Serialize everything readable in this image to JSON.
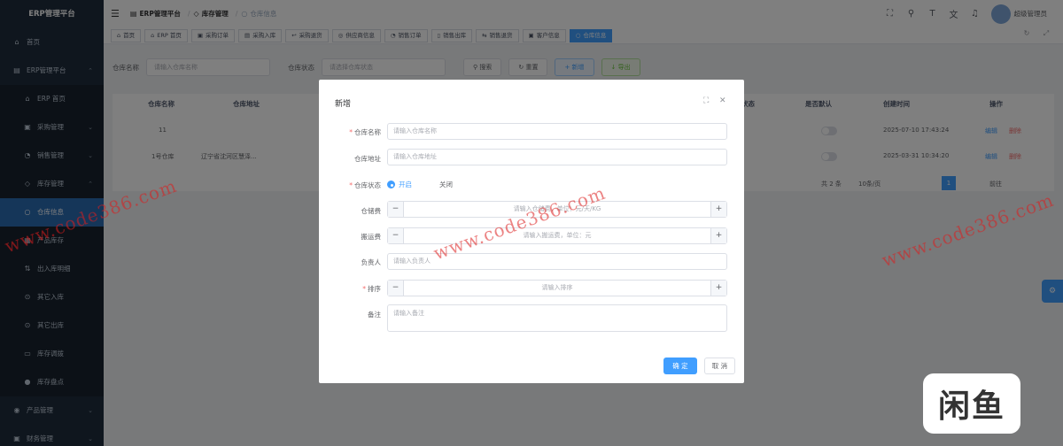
{
  "sidebar": {
    "logo": "ERP管理平台",
    "items": [
      {
        "icon": "home-icon",
        "glyph": "⌂",
        "label": "首页",
        "arrow": ""
      },
      {
        "icon": "server-icon",
        "glyph": "▤",
        "label": "ERP管理平台",
        "arrow": "⌃"
      },
      {
        "icon": "home-icon",
        "glyph": "⌂",
        "label": "ERP 首页",
        "arrow": "",
        "sub": true
      },
      {
        "icon": "purchase-icon",
        "glyph": "▣",
        "label": "采购管理",
        "arrow": "⌄",
        "sub": true
      },
      {
        "icon": "sales-icon",
        "glyph": "◔",
        "label": "销售管理",
        "arrow": "⌄",
        "sub": true
      },
      {
        "icon": "stock-icon",
        "glyph": "◇",
        "label": "库存管理",
        "arrow": "⌃",
        "sub": true
      },
      {
        "icon": "warehouse-icon",
        "glyph": "○",
        "label": "仓库信息",
        "arrow": "",
        "sub": true,
        "active": true
      },
      {
        "icon": "inventory-icon",
        "glyph": "▦",
        "label": "产品库存",
        "arrow": "",
        "sub": true
      },
      {
        "icon": "flow-icon",
        "glyph": "⇅",
        "label": "出入库明细",
        "arrow": "",
        "sub": true
      },
      {
        "icon": "in-icon",
        "glyph": "⊙",
        "label": "其它入库",
        "arrow": "",
        "sub": true
      },
      {
        "icon": "out-icon",
        "glyph": "⊙",
        "label": "其它出库",
        "arrow": "",
        "sub": true
      },
      {
        "icon": "transfer-icon",
        "glyph": "▭",
        "label": "库存调拨",
        "arrow": "",
        "sub": true
      },
      {
        "icon": "check-icon",
        "glyph": "●",
        "label": "库存盘点",
        "arrow": "",
        "sub": true
      },
      {
        "icon": "product-icon",
        "glyph": "◉",
        "label": "产品管理",
        "arrow": "⌄"
      },
      {
        "icon": "finance-icon",
        "glyph": "▣",
        "label": "财务管理",
        "arrow": "⌄"
      }
    ]
  },
  "topbar": {
    "breadcrumb": [
      "ERP管理平台",
      "库存管理",
      "仓库信息"
    ],
    "username": "超级管理员"
  },
  "tags": [
    {
      "label": "首页",
      "glyph": "⌂"
    },
    {
      "label": "ERP 首页",
      "glyph": "⌂"
    },
    {
      "label": "采购订单",
      "glyph": "▣"
    },
    {
      "label": "采购入库",
      "glyph": "▤"
    },
    {
      "label": "采购退货",
      "glyph": "↩"
    },
    {
      "label": "供应商信息",
      "glyph": "◎"
    },
    {
      "label": "销售订单",
      "glyph": "◔"
    },
    {
      "label": "销售出库",
      "glyph": "▯"
    },
    {
      "label": "销售退货",
      "glyph": "⇆"
    },
    {
      "label": "客户信息",
      "glyph": "▣"
    },
    {
      "label": "仓库信息",
      "glyph": "○",
      "active": true
    }
  ],
  "search": {
    "name_label": "仓库名称",
    "name_placeholder": "请输入仓库名称",
    "status_label": "仓库状态",
    "status_placeholder": "请选择仓库状态",
    "search_btn": "搜索",
    "reset_btn": "重置",
    "add_btn": "新增",
    "export_btn": "导出"
  },
  "table": {
    "headers": {
      "name": "仓库名称",
      "address": "仓库地址",
      "status": "状态",
      "default": "是否默认",
      "created": "创建时间",
      "actions": "操作"
    },
    "rows": [
      {
        "name": "11",
        "address": "",
        "created": "2025-07-10 17:43:24"
      },
      {
        "name": "1号仓库",
        "address": "辽宁省沈河区慧泽...",
        "created": "2025-03-31 10:34:20"
      }
    ],
    "edit": "编辑",
    "delete": "删除"
  },
  "pager": {
    "total": "共 2 条",
    "size": "10条/页",
    "page": "1",
    "goto": "前往"
  },
  "dialog": {
    "title": "新增",
    "fields": {
      "name": {
        "label": "仓库名称",
        "placeholder": "请输入仓库名称"
      },
      "address": {
        "label": "仓库地址",
        "placeholder": "请输入仓库地址"
      },
      "status": {
        "label": "仓库状态",
        "on": "开启",
        "off": "关闭"
      },
      "storage": {
        "label": "仓储费",
        "placeholder": "请输入仓储费，单位：元/天/KG"
      },
      "handling": {
        "label": "搬运费",
        "placeholder": "请输入搬运费，单位：元"
      },
      "principal": {
        "label": "负责人",
        "placeholder": "请输入负责人"
      },
      "sort": {
        "label": "排序",
        "placeholder": "请输入排序"
      },
      "remark": {
        "label": "备注",
        "placeholder": "请输入备注"
      }
    },
    "ok": "确 定",
    "cancel": "取 消"
  },
  "watermark": "www.code386.com",
  "badge": "闲鱼",
  "colors": {
    "primary": "#409eff",
    "sidebar": "#1f2d3d",
    "danger": "#f56c6c"
  }
}
